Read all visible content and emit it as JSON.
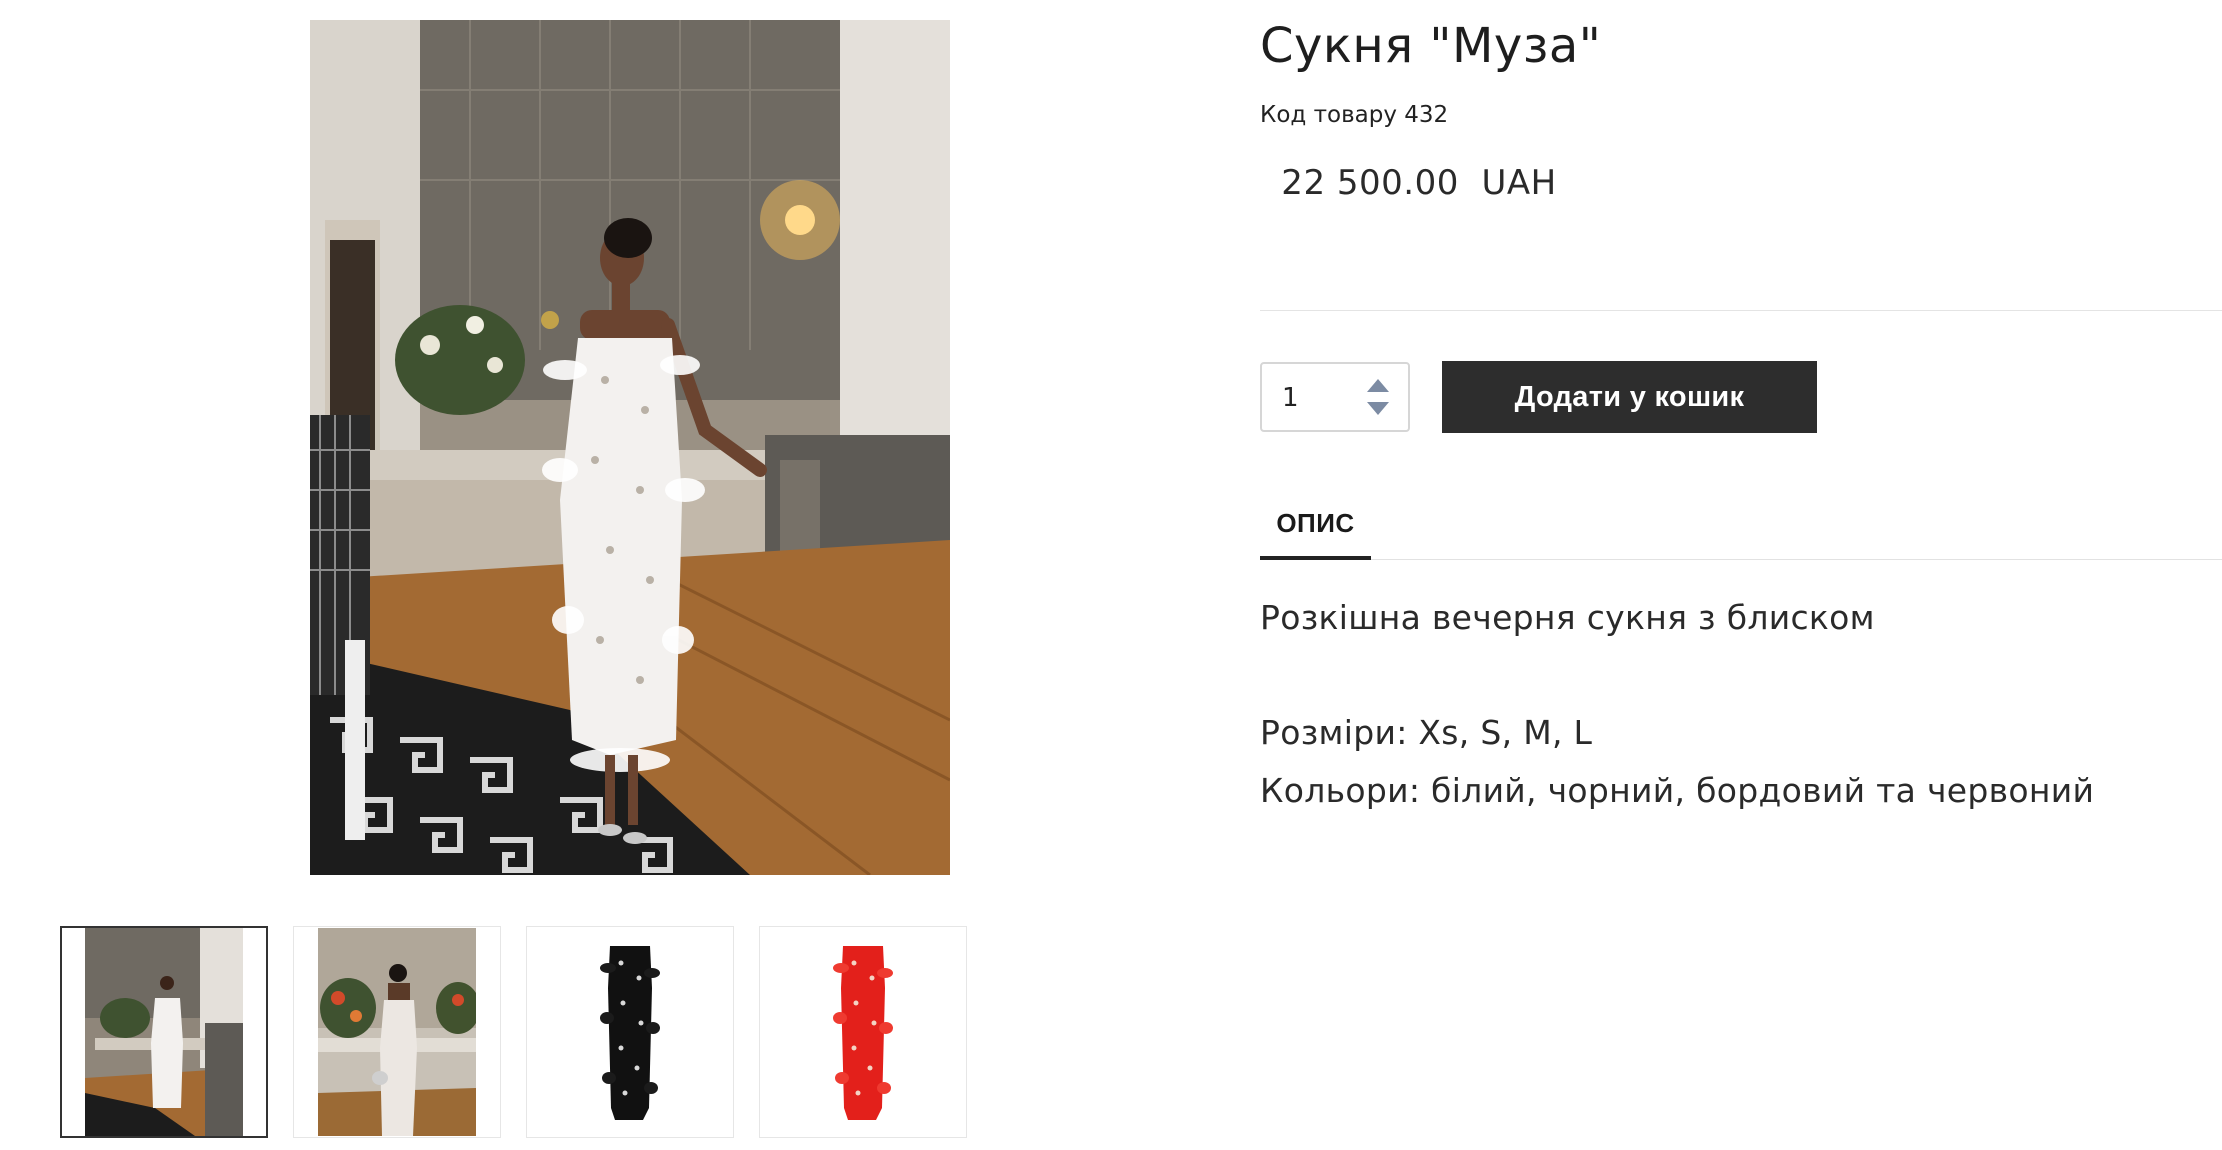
{
  "product": {
    "title": "Сукня \"Муза\"",
    "sku": "Код товару 432",
    "price": " 22 500.00  UAH"
  },
  "cart": {
    "quantity": "1",
    "add_label": "Додати у кошик"
  },
  "tabs": [
    {
      "label": "ОПИС",
      "active": true
    }
  ],
  "description": {
    "line1": "Розкішна вечерня сукня з блиском",
    "line2": "Розміри: Xs, S, M, L",
    "line3": "Кольори: білий, чорний, бордовий та червоний"
  },
  "gallery": {
    "thumbnails": [
      {
        "name": "white-dress-front",
        "active": true
      },
      {
        "name": "white-dress-back",
        "active": false
      },
      {
        "name": "black-dress",
        "active": false
      },
      {
        "name": "red-dress",
        "active": false
      }
    ]
  },
  "colors": {
    "button_bg": "#2d2d2d",
    "stepper_arrow": "#7c8ba3",
    "red_dress": "#e3201b",
    "black_dress": "#111111"
  }
}
